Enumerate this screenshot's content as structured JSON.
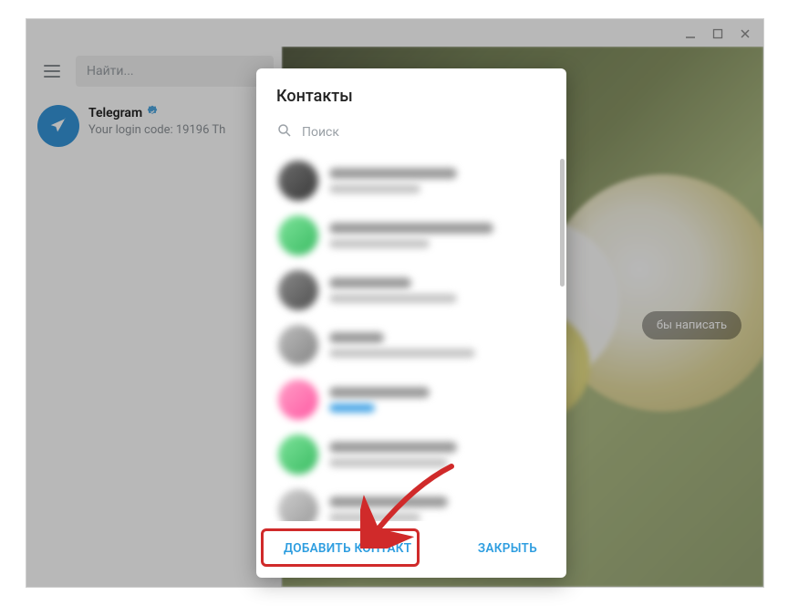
{
  "sidebar": {
    "search_placeholder": "Найти...",
    "chat": {
      "title": "Telegram",
      "subtitle": "Your login code: 19196  Th"
    }
  },
  "main": {
    "pill_text": "бы написать"
  },
  "modal": {
    "title": "Контакты",
    "search_placeholder": "Поиск",
    "add_contact_label": "ДОБАВИТЬ КОНТАКТ",
    "close_label": "ЗАКРЫТЬ"
  }
}
